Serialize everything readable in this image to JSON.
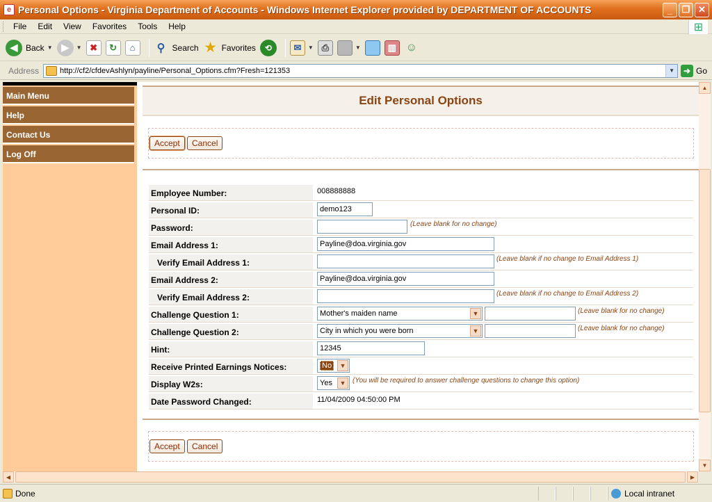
{
  "window": {
    "title": "Personal Options - Virginia Department of Accounts - Windows Internet Explorer provided by DEPARTMENT OF ACCOUNTS"
  },
  "menu": [
    "File",
    "Edit",
    "View",
    "Favorites",
    "Tools",
    "Help"
  ],
  "toolbar": {
    "back": "Back",
    "search": "Search",
    "favorites": "Favorites"
  },
  "address": {
    "label": "Address",
    "url": "http://cf2/cfdevAshlyn/payline/Personal_Options.cfm?Fresh=121353",
    "go": "Go"
  },
  "sidebar": {
    "items": [
      "Main Menu",
      "Help",
      "Contact Us",
      "Log Off"
    ]
  },
  "page": {
    "title": "Edit Personal Options",
    "accept": "Accept",
    "cancel": "Cancel"
  },
  "form": {
    "employee_number": {
      "label": "Employee Number:",
      "value": "008888888"
    },
    "personal_id": {
      "label": "Personal ID:",
      "value": "demo123"
    },
    "password": {
      "label": "Password:",
      "value": "",
      "hint": "(Leave blank for no change)"
    },
    "email1": {
      "label": "Email Address 1:",
      "value": "Payline@doa.virginia.gov"
    },
    "verify_email1": {
      "label": "Verify Email Address 1:",
      "value": "",
      "hint": "(Leave blank if no change to Email Address 1)"
    },
    "email2": {
      "label": "Email Address 2:",
      "value": "Payline@doa.virginia.gov"
    },
    "verify_email2": {
      "label": "Verify Email Address 2:",
      "value": "",
      "hint": "(Leave blank if no change to Email Address 2)"
    },
    "challenge1": {
      "label": "Challenge Question 1:",
      "question": "Mother's maiden name",
      "answer": "",
      "hint": "(Leave blank for no change)"
    },
    "challenge2": {
      "label": "Challenge Question 2:",
      "question": "City in which you were born",
      "answer": "",
      "hint": "(Leave blank for no change)"
    },
    "hint": {
      "label": "Hint:",
      "value": "12345"
    },
    "printed_notices": {
      "label": "Receive Printed Earnings Notices:",
      "value": "No"
    },
    "display_w2s": {
      "label": "Display W2s:",
      "value": "Yes",
      "hint": "(You will be required to answer challenge questions to change this option)"
    },
    "date_password_changed": {
      "label": "Date Password Changed:",
      "value": "11/04/2009 04:50:00 PM"
    }
  },
  "status": {
    "text": "Done",
    "zone": "Local intranet"
  }
}
